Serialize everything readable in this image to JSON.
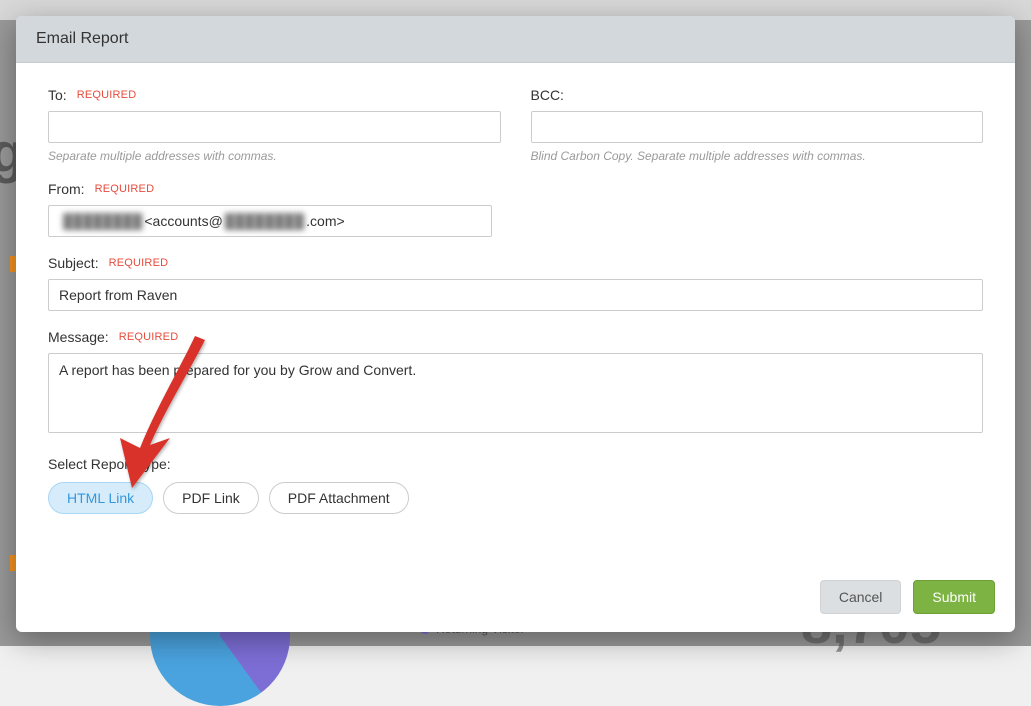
{
  "modal": {
    "title": "Email Report",
    "to": {
      "label": "To:",
      "required": "REQUIRED",
      "value": "",
      "help": "Separate multiple addresses with commas."
    },
    "bcc": {
      "label": "BCC:",
      "value": "",
      "help": "Blind Carbon Copy. Separate multiple addresses with commas."
    },
    "from": {
      "label": "From:",
      "required": "REQUIRED",
      "blurred_name": "████████",
      "value_visible": "<accounts@",
      "blurred_domain": "████████",
      "value_suffix": ".com>"
    },
    "subject": {
      "label": "Subject:",
      "required": "REQUIRED",
      "value": "Report from Raven"
    },
    "message": {
      "label": "Message:",
      "required": "REQUIRED",
      "value": "A report has been prepared for you by Grow and Convert."
    },
    "report_type": {
      "label": "Select Report Type:",
      "options": [
        {
          "label": "HTML Link",
          "active": true
        },
        {
          "label": "PDF Link",
          "active": false
        },
        {
          "label": "PDF Attachment",
          "active": false
        }
      ]
    },
    "footer": {
      "cancel": "Cancel",
      "submit": "Submit"
    }
  },
  "background": {
    "legend": "Returning Visitor"
  }
}
